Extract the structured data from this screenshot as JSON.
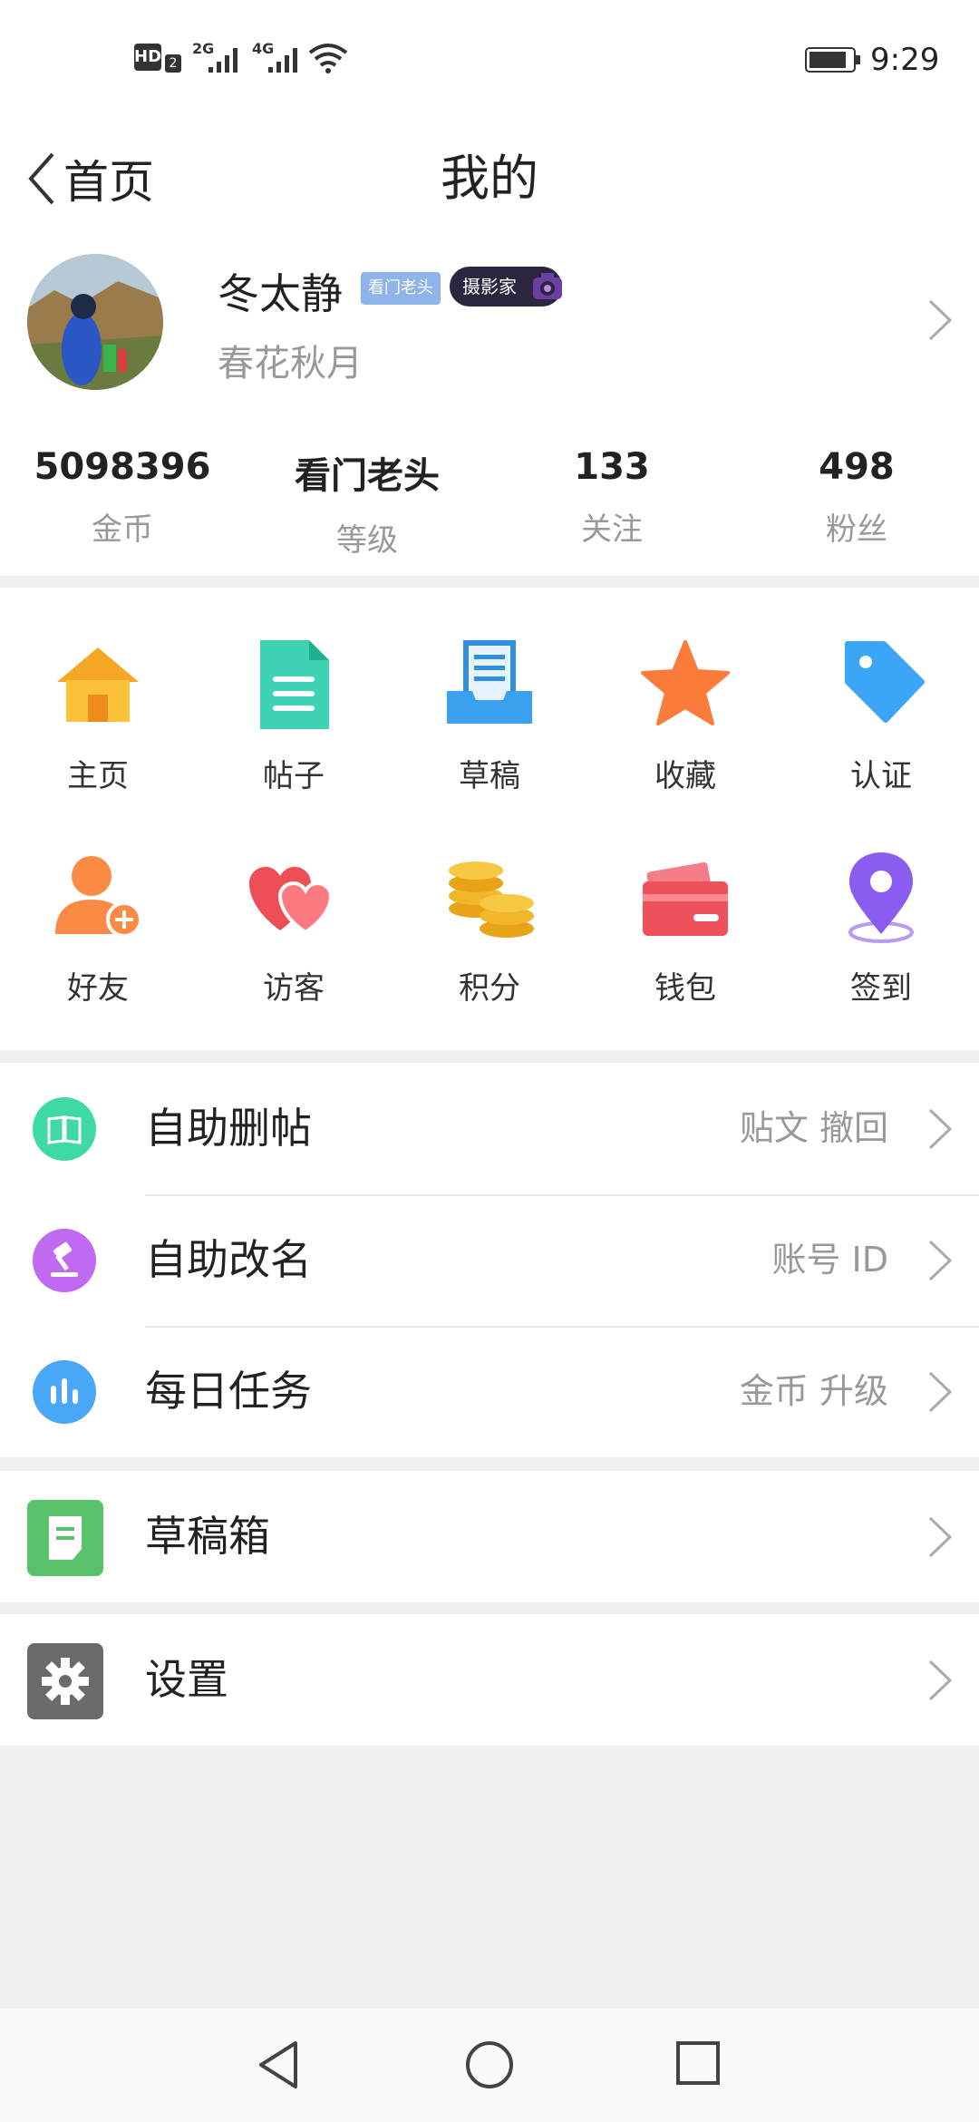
{
  "status": {
    "hd": "HD",
    "hd_sub": "2",
    "sig1": "2G",
    "sig2": "4G",
    "time": "9:29"
  },
  "header": {
    "back_label": "首页",
    "title": "我的"
  },
  "profile": {
    "name": "冬太静",
    "level_badge": "看门老头",
    "title_badge": "摄影家",
    "signature": "春花秋月",
    "stats": [
      {
        "value": "5098396",
        "label": "金币"
      },
      {
        "value": "看门老头",
        "label": "等级"
      },
      {
        "value": "133",
        "label": "关注"
      },
      {
        "value": "498",
        "label": "粉丝"
      }
    ]
  },
  "grid": [
    {
      "label": "主页",
      "icon": "home-icon"
    },
    {
      "label": "帖子",
      "icon": "document-icon"
    },
    {
      "label": "草稿",
      "icon": "draft-tray-icon"
    },
    {
      "label": "收藏",
      "icon": "star-icon"
    },
    {
      "label": "认证",
      "icon": "tag-icon"
    },
    {
      "label": "好友",
      "icon": "add-friend-icon"
    },
    {
      "label": "访客",
      "icon": "hearts-icon"
    },
    {
      "label": "积分",
      "icon": "coins-icon"
    },
    {
      "label": "钱包",
      "icon": "wallet-icon"
    },
    {
      "label": "签到",
      "icon": "location-pin-icon"
    }
  ],
  "menu": {
    "group1": [
      {
        "label": "自助删帖",
        "hint": "贴文  撤回",
        "icon": "book-icon"
      },
      {
        "label": "自助改名",
        "hint": "账号  ID",
        "icon": "gavel-icon"
      },
      {
        "label": "每日任务",
        "hint": "金币  升级",
        "icon": "bar-chart-icon"
      }
    ],
    "drafts": {
      "label": "草稿箱",
      "icon": "draft-box-icon"
    },
    "settings": {
      "label": "设置",
      "icon": "gear-icon"
    }
  },
  "colors": {
    "accent_green": "#5ac26b",
    "gear_gray": "#6b6b6b"
  }
}
